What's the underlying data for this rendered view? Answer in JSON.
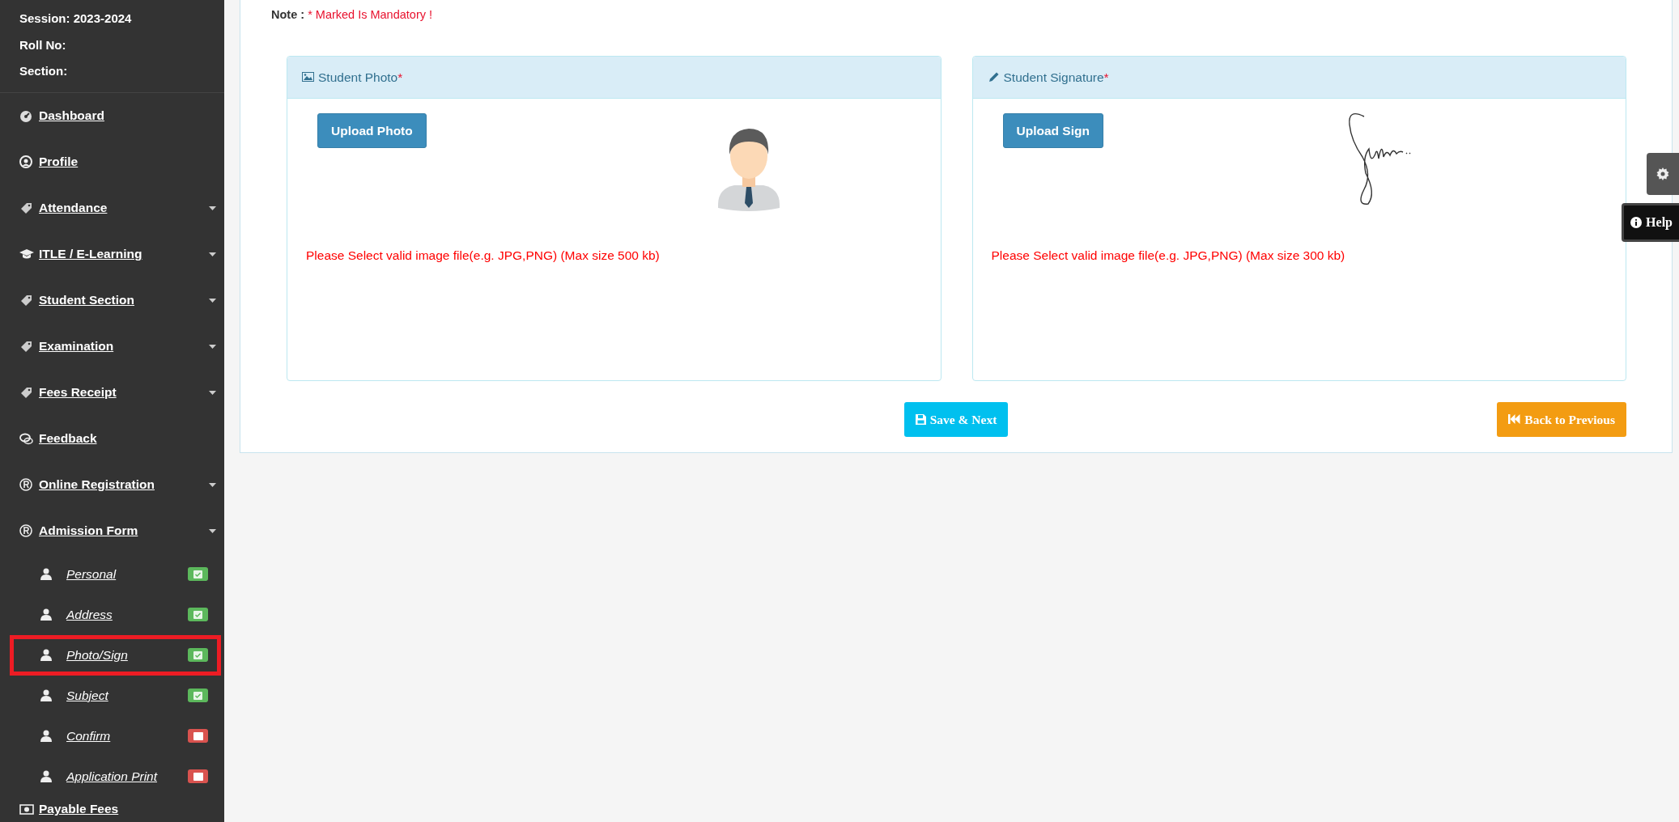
{
  "sidebar": {
    "info": [
      "Session: 2023-2024",
      "Roll No:",
      "Section:"
    ],
    "items": [
      {
        "label": "Dashboard",
        "expandable": false
      },
      {
        "label": "Profile",
        "expandable": false
      },
      {
        "label": "Attendance",
        "expandable": true
      },
      {
        "label": "ITLE / E-Learning",
        "expandable": true
      },
      {
        "label": "Student Section",
        "expandable": true
      },
      {
        "label": "Examination",
        "expandable": true
      },
      {
        "label": "Fees Receipt",
        "expandable": true
      },
      {
        "label": "Feedback",
        "expandable": false
      },
      {
        "label": "Online Registration",
        "expandable": true
      },
      {
        "label": "Admission Form",
        "expandable": true,
        "children": [
          {
            "label": "Personal",
            "complete": true,
            "selected": false
          },
          {
            "label": "Address",
            "complete": true,
            "selected": false
          },
          {
            "label": "Photo/Sign",
            "complete": true,
            "selected": true
          },
          {
            "label": "Subject",
            "complete": true,
            "selected": false
          },
          {
            "label": "Confirm",
            "complete": false,
            "selected": false
          },
          {
            "label": "Application Print",
            "complete": false,
            "selected": false
          }
        ]
      },
      {
        "label": "Payable Fees",
        "expandable": false
      }
    ]
  },
  "note": {
    "label": "Note :",
    "text": "* Marked Is Mandatory !"
  },
  "panels": [
    {
      "title": "Student Photo",
      "required_mark": " *",
      "button": "Upload Photo",
      "hint": "Please Select valid image file(e.g. JPG,PNG) (Max size 500 kb)"
    },
    {
      "title": "Student Signature",
      "required_mark": "*",
      "button": "Upload Sign",
      "hint": "Please Select valid image file(e.g. JPG,PNG) (Max size 300 kb)"
    }
  ],
  "actions": {
    "save": "Save & Next",
    "back": "Back to Previous"
  },
  "side_tabs": {
    "help": "Help"
  }
}
